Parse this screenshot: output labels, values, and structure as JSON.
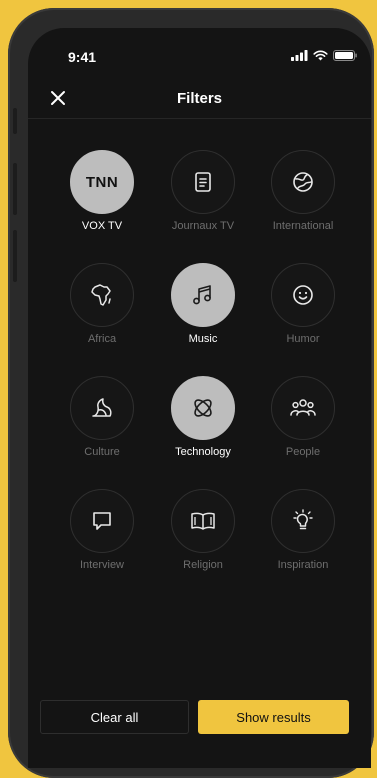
{
  "status_bar": {
    "time": "9:41"
  },
  "header": {
    "title": "Filters",
    "close_icon": "close-icon"
  },
  "categories": [
    {
      "label": "VOX TV",
      "logo_text": "TNN",
      "icon": "tnn-logo",
      "selected": true
    },
    {
      "label": "Journaux TV",
      "icon": "document-icon",
      "selected": false
    },
    {
      "label": "International",
      "icon": "globe-icon",
      "selected": false
    },
    {
      "label": "Africa",
      "icon": "africa-map-icon",
      "selected": false
    },
    {
      "label": "Music",
      "icon": "music-note-icon",
      "selected": true
    },
    {
      "label": "Humor",
      "icon": "smiley-icon",
      "selected": false
    },
    {
      "label": "Culture",
      "icon": "leaf-icon",
      "selected": false
    },
    {
      "label": "Technology",
      "icon": "atom-icon",
      "selected": true
    },
    {
      "label": "People",
      "icon": "people-icon",
      "selected": false
    },
    {
      "label": "Interview",
      "icon": "chat-bubble-icon",
      "selected": false
    },
    {
      "label": "Religion",
      "icon": "book-icon",
      "selected": false
    },
    {
      "label": "Inspiration",
      "icon": "lightbulb-icon",
      "selected": false
    }
  ],
  "footer": {
    "clear_label": "Clear all",
    "show_label": "Show results"
  },
  "colors": {
    "accent": "#f0c53f",
    "background": "#141414",
    "selected_circle": "#bdbdbd",
    "inactive_label": "#6e6e6e"
  }
}
